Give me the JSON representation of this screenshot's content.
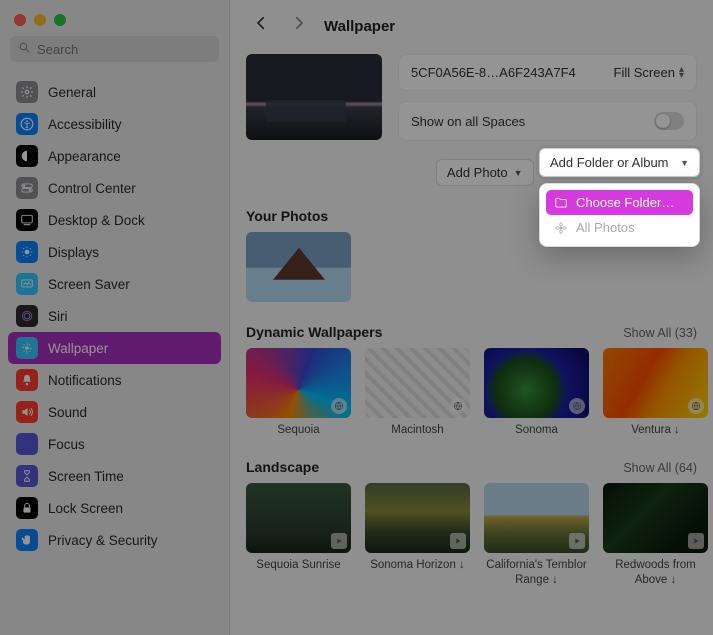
{
  "window": {
    "search_placeholder": "Search",
    "title": "Wallpaper"
  },
  "sidebar": {
    "items": [
      {
        "label": "General",
        "icon": "gear",
        "bg": "#8e8e93"
      },
      {
        "label": "Accessibility",
        "icon": "accessibility",
        "bg": "#0a84ff"
      },
      {
        "label": "Appearance",
        "icon": "appearance",
        "bg": "#000000"
      },
      {
        "label": "Control Center",
        "icon": "switches",
        "bg": "#8e8e93"
      },
      {
        "label": "Desktop & Dock",
        "icon": "dock",
        "bg": "#000000"
      },
      {
        "label": "Displays",
        "icon": "displays",
        "bg": "#0a84ff"
      },
      {
        "label": "Screen Saver",
        "icon": "screensaver",
        "bg": "#34c8ff"
      },
      {
        "label": "Siri",
        "icon": "siri",
        "bg": "#2c2c2e"
      },
      {
        "label": "Wallpaper",
        "icon": "wallpaper",
        "bg": "#34c8ff",
        "selected": true
      },
      {
        "label": "Notifications",
        "icon": "bell",
        "bg": "#ff3b30"
      },
      {
        "label": "Sound",
        "icon": "sound",
        "bg": "#ff3b30"
      },
      {
        "label": "Focus",
        "icon": "moon",
        "bg": "#5856d6"
      },
      {
        "label": "Screen Time",
        "icon": "hourglass",
        "bg": "#5856d6"
      },
      {
        "label": "Lock Screen",
        "icon": "lock",
        "bg": "#000000"
      },
      {
        "label": "Privacy & Security",
        "icon": "hand",
        "bg": "#0a84ff"
      }
    ]
  },
  "wallpaper": {
    "current_name": "5CF0A56E-8…A6F243A7F4",
    "fill_mode": "Fill Screen",
    "show_on_all_spaces_label": "Show on all Spaces",
    "add_photo_label": "Add Photo",
    "add_folder_label": "Add Folder or Album"
  },
  "dropdown": {
    "choose_folder": "Choose Folder…",
    "all_photos": "All Photos"
  },
  "sections": {
    "your_photos": {
      "title": "Your Photos"
    },
    "dynamic": {
      "title": "Dynamic Wallpapers",
      "show_all": "Show All (33)",
      "items": [
        {
          "label": "Sequoia",
          "art": "t-sequoia"
        },
        {
          "label": "Macintosh",
          "art": "t-mac"
        },
        {
          "label": "Sonoma",
          "art": "t-sonoma"
        },
        {
          "label": "Ventura ↓",
          "art": "t-ventura"
        }
      ]
    },
    "landscape": {
      "title": "Landscape",
      "show_all": "Show All (64)",
      "items": [
        {
          "label": "Sequoia Sunrise",
          "art": "t-seqsun"
        },
        {
          "label": "Sonoma Horizon ↓",
          "art": "t-sonhor"
        },
        {
          "label": "California's Temblor Range ↓",
          "art": "t-calif"
        },
        {
          "label": "Redwoods from Above ↓",
          "art": "t-redw"
        }
      ]
    }
  }
}
